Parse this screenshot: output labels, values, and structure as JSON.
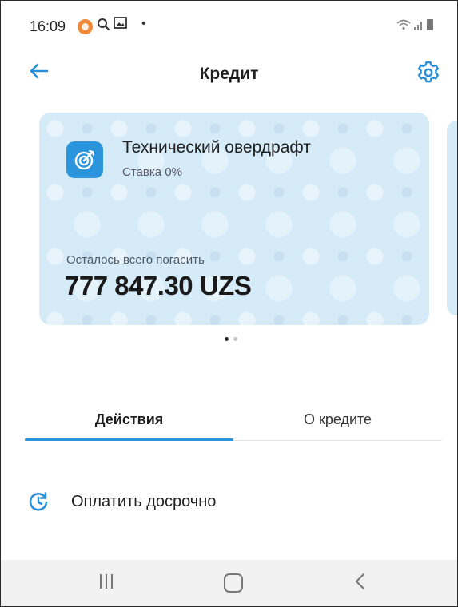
{
  "status_bar": {
    "time": "16:09",
    "icons": [
      "notification-dot-icon",
      "search-icon",
      "gallery-icon",
      "dot-icon",
      "wifi-icon",
      "signal-icon",
      "battery-icon"
    ]
  },
  "header": {
    "title": "Кредит",
    "back_icon": "arrow-left-icon",
    "settings_icon": "gear-icon"
  },
  "card": {
    "title": "Технический овердрафт",
    "rate": "Ставка 0%",
    "remaining_label": "Осталось всего погасить",
    "amount": "777 847.30 UZS",
    "icon": "target-icon"
  },
  "pager": {
    "count": 2,
    "active_index": 0
  },
  "tabs": [
    {
      "label": "Действия",
      "active": true
    },
    {
      "label": "О кредите",
      "active": false
    }
  ],
  "actions": [
    {
      "label": "Оплатить досрочно",
      "icon": "clock-refresh-icon"
    }
  ],
  "nav_bar": {
    "icons": [
      "recent-apps-icon",
      "home-icon",
      "back-icon"
    ]
  },
  "colors": {
    "accent": "#2a94dc",
    "card_background": "#d6ebf8",
    "nav_background": "#f1f1f1",
    "notification": "#f08a3a"
  }
}
